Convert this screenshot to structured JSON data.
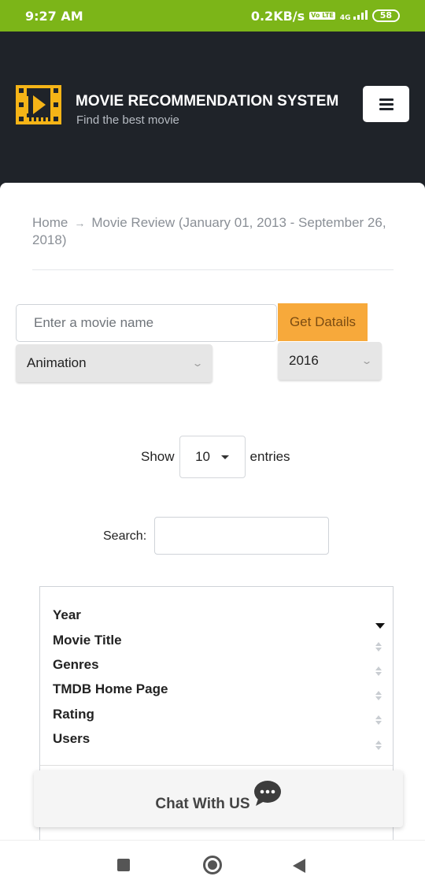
{
  "status": {
    "time": "9:27 AM",
    "speed": "0.2KB/s",
    "network": "4G",
    "volte": "Vo LTE",
    "battery": "58"
  },
  "header": {
    "title": "MOVIE RECOMMENDATION SYSTEM",
    "subtitle": "Find the best movie"
  },
  "breadcrumb": {
    "home": "Home",
    "arrow": "→",
    "current": "Movie Review (January 01, 2013 - September 26, 2018)"
  },
  "form": {
    "movie_placeholder": "Enter a movie name",
    "submit_label": "Get Datails",
    "genre": "Animation",
    "year": "2016"
  },
  "table_controls": {
    "show_label": "Show",
    "entries_value": "10",
    "entries_label": "entries",
    "search_label": "Search:"
  },
  "table": {
    "columns": [
      "Year",
      "Movie Title",
      "Genres",
      "TMDB Home Page",
      "Rating",
      "Users"
    ]
  },
  "chat": {
    "label": "Chat With US"
  },
  "colors": {
    "status_bar": "#7cb518",
    "header_bg": "#1f2329",
    "accent": "#f7a93b"
  }
}
